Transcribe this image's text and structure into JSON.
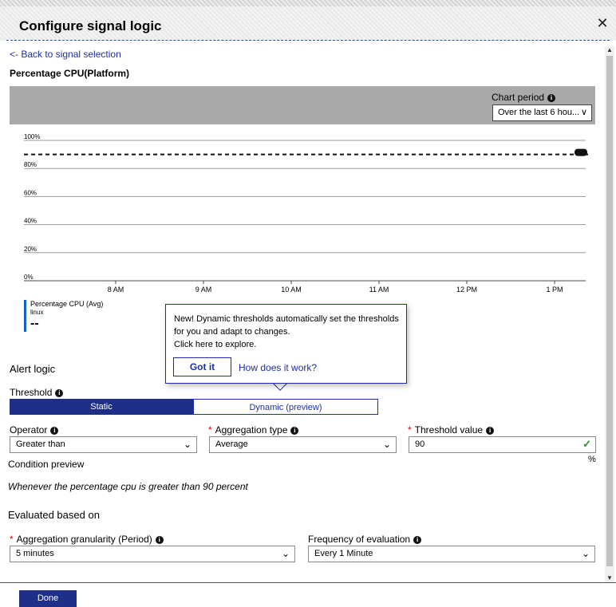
{
  "window": {
    "title": "Configure signal logic"
  },
  "nav": {
    "back_label": "<- Back to signal selection"
  },
  "metric": {
    "title": "Percentage CPU(Platform)"
  },
  "chart_period": {
    "label": "Chart period",
    "selected": "Over the last 6 hou..."
  },
  "chart_data": {
    "type": "line",
    "x_ticks": [
      "8 AM",
      "9 AM",
      "10 AM",
      "11 AM",
      "12 PM",
      "1 PM"
    ],
    "y_ticks": [
      "100%",
      "80%",
      "60%",
      "40%",
      "20%",
      "0%"
    ],
    "ylim": [
      0,
      100
    ],
    "threshold": 90,
    "legend": {
      "name": "Percentage CPU (Avg)",
      "sub": "linux",
      "value": "--"
    }
  },
  "callout": {
    "lines": [
      "New! Dynamic thresholds automatically set the thresholds",
      "for you and adapt to changes.",
      "Click here to explore."
    ],
    "got_it": "Got it",
    "how_link": "How does it work?"
  },
  "alert_logic": {
    "heading": "Alert logic",
    "threshold_label": "Threshold",
    "static_label": "Static",
    "dynamic_label": "Dynamic (preview)"
  },
  "fields": {
    "operator": {
      "label": "Operator",
      "value": "Greater than"
    },
    "aggregation_type": {
      "label": "Aggregation type",
      "value": "Average"
    },
    "threshold_value": {
      "label": "Threshold value",
      "value": "90",
      "unit": "%"
    }
  },
  "condition": {
    "label": "Condition preview",
    "text": "Whenever the percentage cpu is greater than 90 percent"
  },
  "evaluation": {
    "heading": "Evaluated based on",
    "granularity": {
      "label": "Aggregation granularity (Period)",
      "value": "5 minutes"
    },
    "frequency": {
      "label": "Frequency of evaluation",
      "value": "Every 1 Minute"
    }
  },
  "footer": {
    "done_label": "Done"
  },
  "colors": {
    "accent": "#1e2f8a",
    "link": "#1e2fa3",
    "required": "#d0021b",
    "valid": "#2e8b2e"
  }
}
